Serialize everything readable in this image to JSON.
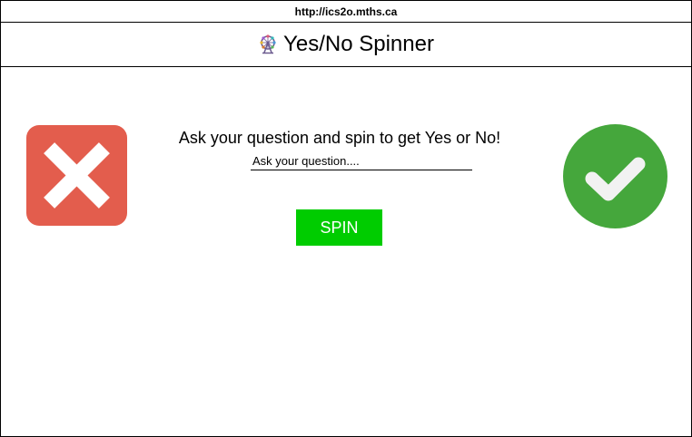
{
  "browser": {
    "url": "http://ics2o.mths.ca"
  },
  "header": {
    "icon": "ferris-wheel-icon",
    "title": "Yes/No Spinner"
  },
  "main": {
    "prompt": "Ask your question and spin to get Yes or No!",
    "question_input": {
      "placeholder": "Ask your question....",
      "value": ""
    },
    "spin_label": "SPIN",
    "no_icon": "red-x-icon",
    "yes_icon": "green-check-icon"
  },
  "colors": {
    "spin_button": "#00cc00",
    "no_icon": "#e35d4d",
    "yes_icon": "#45a73c"
  }
}
